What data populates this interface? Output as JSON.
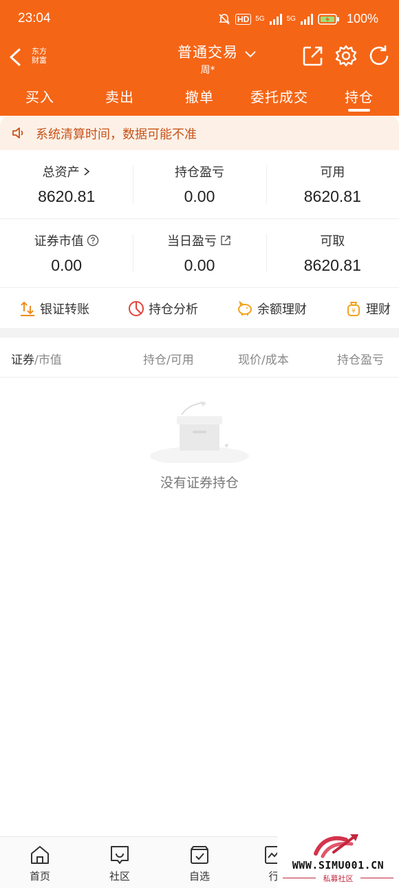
{
  "status_bar": {
    "time": "23:04",
    "network_1": "5G",
    "network_2": "5G",
    "hd_badge": "HD",
    "battery": "100%"
  },
  "header": {
    "logo_text": "东方财富",
    "title": "普通交易",
    "subtitle": "周*",
    "tabs": [
      {
        "label": "买入",
        "active": false
      },
      {
        "label": "卖出",
        "active": false
      },
      {
        "label": "撤单",
        "active": false
      },
      {
        "label": "委托成交",
        "active": false
      },
      {
        "label": "持仓",
        "active": true
      }
    ],
    "brand_color": "#f56516"
  },
  "notice": {
    "text": "系统清算时间，数据可能不准"
  },
  "summary": {
    "row1": [
      {
        "label": "总资产",
        "value": "8620.81",
        "has_chevron": true
      },
      {
        "label": "持仓盈亏",
        "value": "0.00"
      },
      {
        "label": "可用",
        "value": "8620.81"
      }
    ],
    "row2": [
      {
        "label": "证券市值",
        "value": "0.00",
        "has_help": true
      },
      {
        "label": "当日盈亏",
        "value": "0.00",
        "has_link": true
      },
      {
        "label": "可取",
        "value": "8620.81"
      }
    ]
  },
  "quick_actions": [
    {
      "label": "银证转账",
      "icon": "transfer-icon"
    },
    {
      "label": "持仓分析",
      "icon": "pie-chart-icon"
    },
    {
      "label": "余额理财",
      "icon": "piggy-bank-icon"
    },
    {
      "label": "理财",
      "icon": "money-bag-icon"
    }
  ],
  "table_header": {
    "col1_main": "证券",
    "col1_sub": "/市值",
    "col2": "持仓/可用",
    "col3": "现价/成本",
    "col4": "持仓盈亏"
  },
  "empty_state": {
    "text": "没有证券持仓"
  },
  "bottom_nav": [
    {
      "label": "首页",
      "icon": "home-icon"
    },
    {
      "label": "社区",
      "icon": "community-icon"
    },
    {
      "label": "自选",
      "icon": "watchlist-icon"
    },
    {
      "label": "行",
      "icon": "market-icon"
    }
  ],
  "watermark": {
    "url": "WWW.SIMU001.CN",
    "sub": "私募社区"
  }
}
